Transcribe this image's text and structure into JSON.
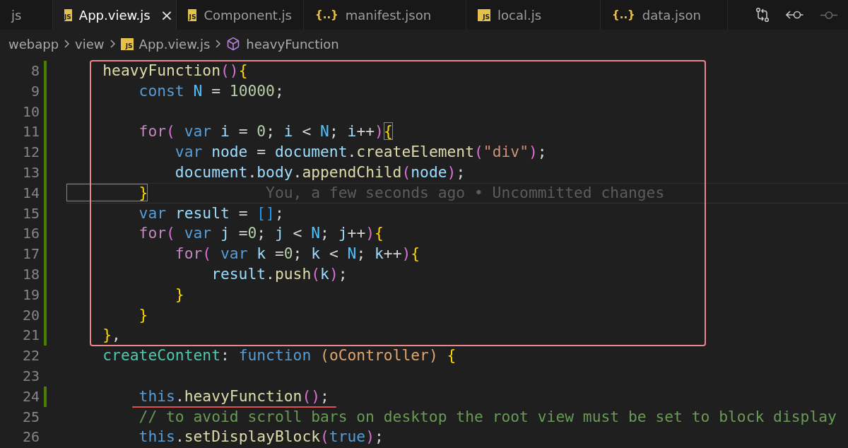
{
  "tabs": [
    {
      "label": "js",
      "selected": false
    },
    {
      "kind": "js",
      "icon": "JS",
      "label": "App.view.js",
      "selected": true,
      "close": "×"
    },
    {
      "kind": "js",
      "icon": "JS",
      "label": "Component.js",
      "selected": false
    },
    {
      "kind": "json",
      "icon": "{..}",
      "label": "manifest.json",
      "selected": false
    },
    {
      "kind": "js",
      "icon": "JS",
      "label": "local.js",
      "selected": false
    },
    {
      "kind": "json",
      "icon": "{..}",
      "label": "data.json",
      "selected": false
    }
  ],
  "breadcrumb": [
    {
      "kind": "folder",
      "label": "webapp"
    },
    {
      "kind": "folder",
      "label": "view"
    },
    {
      "kind": "file",
      "icon": "JS",
      "label": "App.view.js"
    },
    {
      "kind": "symbol",
      "label": "heavyFunction"
    }
  ],
  "blocks": [
    {
      "framed": true,
      "lines": [
        {
          "number": "8",
          "modified": true,
          "tokens": [
            {
              "t": "    heavyFunction",
              "color": "#dcdcaa"
            },
            {
              "t": "()",
              "color": "#da70d6"
            },
            {
              "t": "{",
              "color": "#ffd700"
            }
          ]
        },
        {
          "number": "9",
          "modified": true,
          "tokens": [
            {
              "t": "        const ",
              "color": "#569cd6"
            },
            {
              "t": "N",
              "color": "#4fc1ff"
            },
            {
              "t": " = ",
              "color": "#d4d4d4"
            },
            {
              "t": "10000",
              "color": "#b5cea8"
            },
            {
              "t": ";",
              "color": "#d4d4d4"
            }
          ]
        },
        {
          "number": "10",
          "modified": true
        },
        {
          "number": "11",
          "modified": true,
          "tokens": [
            {
              "t": "        for",
              "color": "#c586c0"
            },
            {
              "t": "( ",
              "color": "#da70d6"
            },
            {
              "t": "var ",
              "color": "#569cd6"
            },
            {
              "t": "i",
              "color": "#9cdcfe"
            },
            {
              "t": " = ",
              "color": "#d4d4d4"
            },
            {
              "t": "0",
              "color": "#b5cea8"
            },
            {
              "t": "; ",
              "color": "#d4d4d4"
            },
            {
              "t": "i",
              "color": "#9cdcfe"
            },
            {
              "t": " < ",
              "color": "#d4d4d4"
            },
            {
              "t": "N",
              "color": "#4fc1ff"
            },
            {
              "t": "; ",
              "color": "#d4d4d4"
            },
            {
              "t": "i",
              "color": "#9cdcfe"
            },
            {
              "t": "++",
              "color": "#d4d4d4"
            },
            {
              "t": ")",
              "color": "#da70d6"
            },
            {
              "t": "{",
              "color": "#ffd700",
              "match": true
            }
          ]
        },
        {
          "number": "12",
          "modified": true,
          "tokens": [
            {
              "t": "            var ",
              "color": "#569cd6"
            },
            {
              "t": "node",
              "color": "#9cdcfe"
            },
            {
              "t": " = ",
              "color": "#d4d4d4"
            },
            {
              "t": "document",
              "color": "#9cdcfe"
            },
            {
              "t": ".",
              "color": "#d4d4d4"
            },
            {
              "t": "createElement",
              "color": "#dcdcaa"
            },
            {
              "t": "(",
              "color": "#da70d6"
            },
            {
              "t": "\"div\"",
              "color": "#ce9178"
            },
            {
              "t": ")",
              "color": "#da70d6"
            },
            {
              "t": ";",
              "color": "#d4d4d4"
            }
          ]
        },
        {
          "number": "13",
          "modified": true,
          "tokens": [
            {
              "t": "            document",
              "color": "#9cdcfe"
            },
            {
              "t": ".",
              "color": "#d4d4d4"
            },
            {
              "t": "body",
              "color": "#9cdcfe"
            },
            {
              "t": ".",
              "color": "#d4d4d4"
            },
            {
              "t": "appendChild",
              "color": "#dcdcaa"
            },
            {
              "t": "(",
              "color": "#da70d6"
            },
            {
              "t": "node",
              "color": "#9cdcfe"
            },
            {
              "t": ")",
              "color": "#da70d6"
            },
            {
              "t": ";",
              "color": "#d4d4d4"
            }
          ]
        },
        {
          "number": "14",
          "modified": true,
          "current": true,
          "blame": "You, a few seconds ago • Uncommitted changes",
          "tokens": [
            {
              "t": "        }",
              "color": "#ffd700",
              "match": true
            }
          ]
        },
        {
          "number": "15",
          "modified": true,
          "tokens": [
            {
              "t": "        var ",
              "color": "#569cd6"
            },
            {
              "t": "result",
              "color": "#9cdcfe"
            },
            {
              "t": " = ",
              "color": "#d4d4d4"
            },
            {
              "t": "[]",
              "color": "#179fff"
            },
            {
              "t": ";",
              "color": "#d4d4d4"
            }
          ]
        },
        {
          "number": "16",
          "modified": true,
          "tokens": [
            {
              "t": "        for",
              "color": "#c586c0"
            },
            {
              "t": "( ",
              "color": "#da70d6"
            },
            {
              "t": "var ",
              "color": "#569cd6"
            },
            {
              "t": "j",
              "color": "#9cdcfe"
            },
            {
              "t": " =",
              "color": "#d4d4d4"
            },
            {
              "t": "0",
              "color": "#b5cea8"
            },
            {
              "t": "; ",
              "color": "#d4d4d4"
            },
            {
              "t": "j",
              "color": "#9cdcfe"
            },
            {
              "t": " < ",
              "color": "#d4d4d4"
            },
            {
              "t": "N",
              "color": "#4fc1ff"
            },
            {
              "t": "; ",
              "color": "#d4d4d4"
            },
            {
              "t": "j",
              "color": "#9cdcfe"
            },
            {
              "t": "++",
              "color": "#d4d4d4"
            },
            {
              "t": ")",
              "color": "#da70d6"
            },
            {
              "t": "{",
              "color": "#ffd700"
            }
          ]
        },
        {
          "number": "17",
          "modified": true,
          "tokens": [
            {
              "t": "            for",
              "color": "#c586c0"
            },
            {
              "t": "( ",
              "color": "#da70d6"
            },
            {
              "t": "var ",
              "color": "#569cd6"
            },
            {
              "t": "k",
              "color": "#9cdcfe"
            },
            {
              "t": " =",
              "color": "#d4d4d4"
            },
            {
              "t": "0",
              "color": "#b5cea8"
            },
            {
              "t": "; ",
              "color": "#d4d4d4"
            },
            {
              "t": "k",
              "color": "#9cdcfe"
            },
            {
              "t": " < ",
              "color": "#d4d4d4"
            },
            {
              "t": "N",
              "color": "#4fc1ff"
            },
            {
              "t": "; ",
              "color": "#d4d4d4"
            },
            {
              "t": "k",
              "color": "#9cdcfe"
            },
            {
              "t": "++",
              "color": "#d4d4d4"
            },
            {
              "t": ")",
              "color": "#da70d6"
            },
            {
              "t": "{",
              "color": "#ffd700"
            }
          ]
        },
        {
          "number": "18",
          "modified": true,
          "tokens": [
            {
              "t": "                result",
              "color": "#9cdcfe"
            },
            {
              "t": ".",
              "color": "#d4d4d4"
            },
            {
              "t": "push",
              "color": "#dcdcaa"
            },
            {
              "t": "(",
              "color": "#da70d6"
            },
            {
              "t": "k",
              "color": "#9cdcfe"
            },
            {
              "t": ")",
              "color": "#da70d6"
            },
            {
              "t": ";",
              "color": "#d4d4d4"
            }
          ]
        },
        {
          "number": "19",
          "modified": true,
          "tokens": [
            {
              "t": "            }",
              "color": "#ffd700"
            }
          ]
        },
        {
          "number": "20",
          "modified": true,
          "tokens": [
            {
              "t": "        }",
              "color": "#ffd700"
            }
          ]
        },
        {
          "number": "21",
          "modified": true,
          "tokens": [
            {
              "t": "    }",
              "color": "#ffd700"
            },
            {
              "t": ",",
              "color": "#d4d4d4"
            }
          ]
        }
      ]
    },
    {
      "framed": false,
      "lines": [
        {
          "number": "22",
          "modified": false,
          "tokens": [
            {
              "t": "    createContent",
              "color": "#4ec9b0"
            },
            {
              "t": ": ",
              "color": "#d4d4d4"
            },
            {
              "t": "function ",
              "color": "#569cd6"
            },
            {
              "t": "(",
              "color": "#e2a56d"
            },
            {
              "t": "oController",
              "color": "#e2a56d"
            },
            {
              "t": ")",
              "color": "#e2a56d"
            },
            {
              "t": " {",
              "color": "#ffd700"
            }
          ]
        },
        {
          "number": "23",
          "modified": false
        },
        {
          "number": "24",
          "modified": true,
          "underlined": true,
          "tokens": [
            {
              "t": "        this",
              "color": "#569cd6"
            },
            {
              "t": ".",
              "color": "#d4d4d4"
            },
            {
              "t": "heavyFunction",
              "color": "#dcdcaa"
            },
            {
              "t": "()",
              "color": "#da70d6"
            },
            {
              "t": ";",
              "color": "#d4d4d4"
            }
          ]
        },
        {
          "number": "25",
          "modified": false,
          "tokens": [
            {
              "t": "        // to avoid scroll bars on desktop the root view must be set to block display",
              "color": "#6a9955"
            }
          ]
        },
        {
          "number": "26",
          "modified": false,
          "tokens": [
            {
              "t": "        this",
              "color": "#569cd6"
            },
            {
              "t": ".",
              "color": "#d4d4d4"
            },
            {
              "t": "setDisplayBlock",
              "color": "#dcdcaa"
            },
            {
              "t": "(",
              "color": "#da70d6"
            },
            {
              "t": "true",
              "color": "#569cd6"
            },
            {
              "t": ")",
              "color": "#da70d6"
            },
            {
              "t": ";",
              "color": "#d4d4d4"
            }
          ]
        }
      ]
    }
  ]
}
